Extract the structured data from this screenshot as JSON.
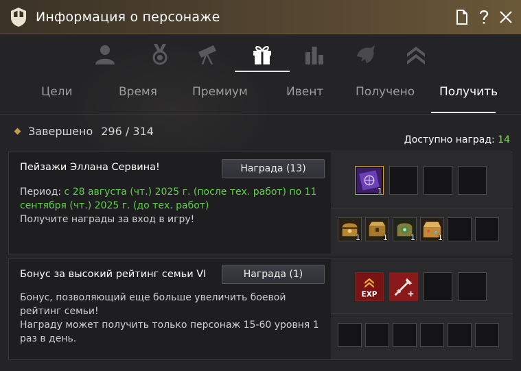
{
  "window": {
    "title": "Информация о персонаже"
  },
  "icon_tabs": [
    {
      "name": "profile-icon",
      "active": false
    },
    {
      "name": "medal-icon",
      "active": false
    },
    {
      "name": "telescope-icon",
      "active": false
    },
    {
      "name": "gift-icon",
      "active": true
    },
    {
      "name": "bar-chart-icon",
      "active": false
    },
    {
      "name": "dragon-icon",
      "active": false
    },
    {
      "name": "rank-chevron-icon",
      "active": false
    }
  ],
  "tabs": [
    {
      "label": "Цели",
      "active": false
    },
    {
      "label": "Время",
      "active": false
    },
    {
      "label": "Премиум",
      "active": false
    },
    {
      "label": "Ивент",
      "active": false
    },
    {
      "label": "Получено",
      "active": false
    },
    {
      "label": "Получить",
      "active": true
    }
  ],
  "summary": {
    "label": "Завершено",
    "value": "296 / 314",
    "available_label": "Доступно наград:",
    "available_count": "14"
  },
  "events": [
    {
      "title": "Пейзажи Эллана Сервина!",
      "button": "Награда (13)",
      "period_label": "Период: ",
      "period_value": "с 28 августа (чт.) 2025 г. (после тех. работ) по 11 сентября (чт.) 2025 г. (до тех. работ)",
      "description": "Получите награды за вход в игру!",
      "top_slot_counts": [
        "1"
      ],
      "bottom_slot_counts": [
        "1",
        "1",
        "1",
        "1"
      ]
    },
    {
      "title": "Бонус за высокий рейтинг семьи VI",
      "button": "Награда (1)",
      "description_1": "Бонус, позволяющий еще больше увеличить боевой рейтинг семьи!",
      "description_2": "Награду может получить только персонаж 15-60 уровня 1 раз в день.",
      "exp_label": "EXP"
    }
  ],
  "colors": {
    "accent_gold": "#c79a4e",
    "highlight_green": "#5fd04a",
    "available_green": "#7fe04a"
  }
}
